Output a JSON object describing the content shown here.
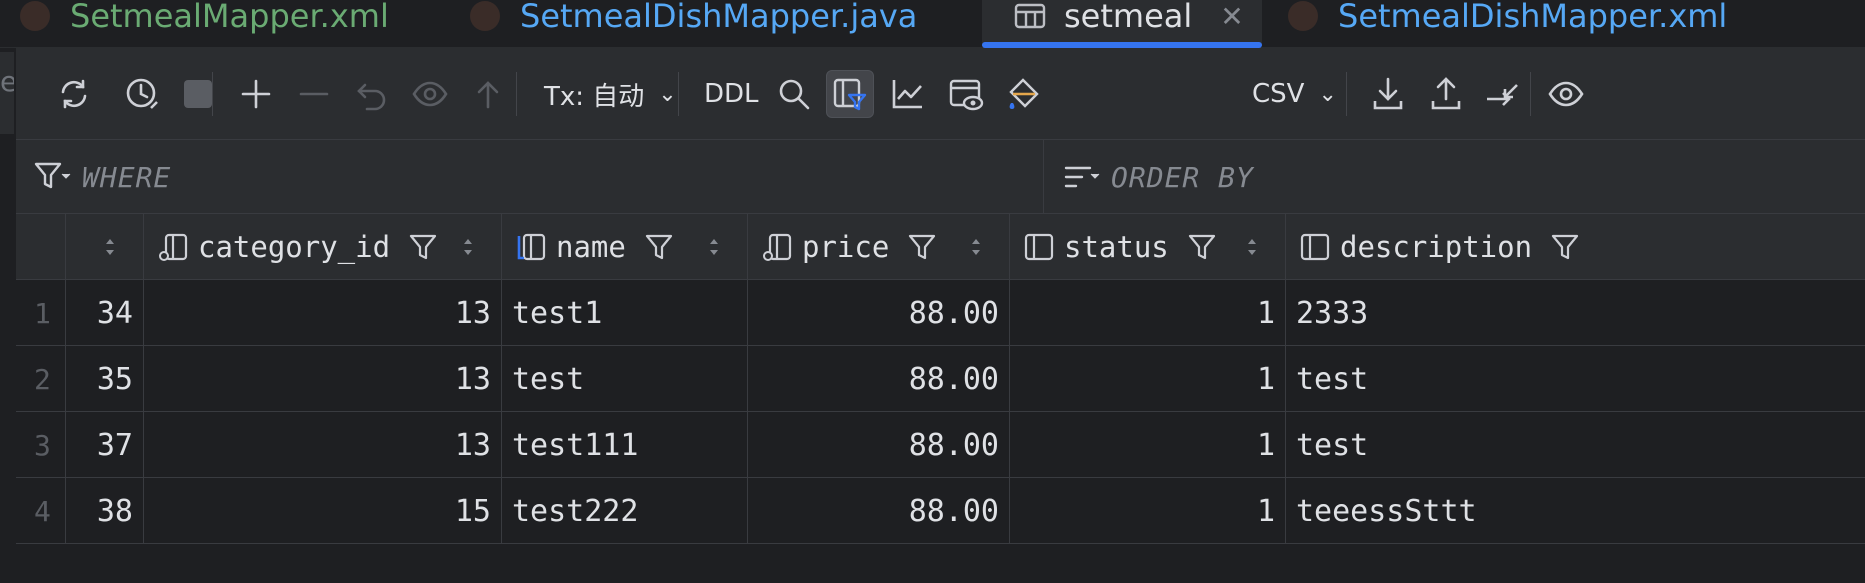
{
  "tabs": [
    {
      "label": "SetmealMapper.xml",
      "color": "#6aab73"
    },
    {
      "label": "SetmealDishMapper.java",
      "color": "#56a8f5"
    },
    {
      "label": "setmeal",
      "active": true
    },
    {
      "label": "SetmealDishMapper.xml",
      "color": "#56a8f5"
    }
  ],
  "gutter_char": "e",
  "toolbar": {
    "icons": [
      "refresh-icon",
      "history-icon",
      "stop-icon",
      "add-row-icon",
      "delete-row-icon",
      "revert-icon",
      "preview-changes-icon",
      "submit-icon",
      "search-icon",
      "filter-panel-icon",
      "chart-icon",
      "view-icon",
      "paint-icon",
      "export-icon",
      "import-icon",
      "compare-icon",
      "eye-icon"
    ],
    "tx_label": "Tx: 自动",
    "ddl_label": "DDL",
    "format_label": "CSV"
  },
  "filter": {
    "where_label": "WHERE",
    "order_label": "ORDER BY"
  },
  "columns": [
    {
      "label": ""
    },
    {
      "label": "category_id"
    },
    {
      "label": "name"
    },
    {
      "label": "price"
    },
    {
      "label": "status"
    },
    {
      "label": "description"
    }
  ],
  "rows": [
    {
      "n": "1",
      "id": "34",
      "category_id": "13",
      "name": "test1",
      "price": "88.00",
      "status": "1",
      "description": "2333"
    },
    {
      "n": "2",
      "id": "35",
      "category_id": "13",
      "name": "test",
      "price": "88.00",
      "status": "1",
      "description": "test"
    },
    {
      "n": "3",
      "id": "37",
      "category_id": "13",
      "name": "test111",
      "price": "88.00",
      "status": "1",
      "description": "test"
    },
    {
      "n": "4",
      "id": "38",
      "category_id": "15",
      "name": "test222",
      "price": "88.00",
      "status": "1",
      "description": "teeessSttt"
    }
  ],
  "colors": {
    "accent": "#3574f0",
    "background": "#1e1f22",
    "panel": "#2b2d30"
  }
}
